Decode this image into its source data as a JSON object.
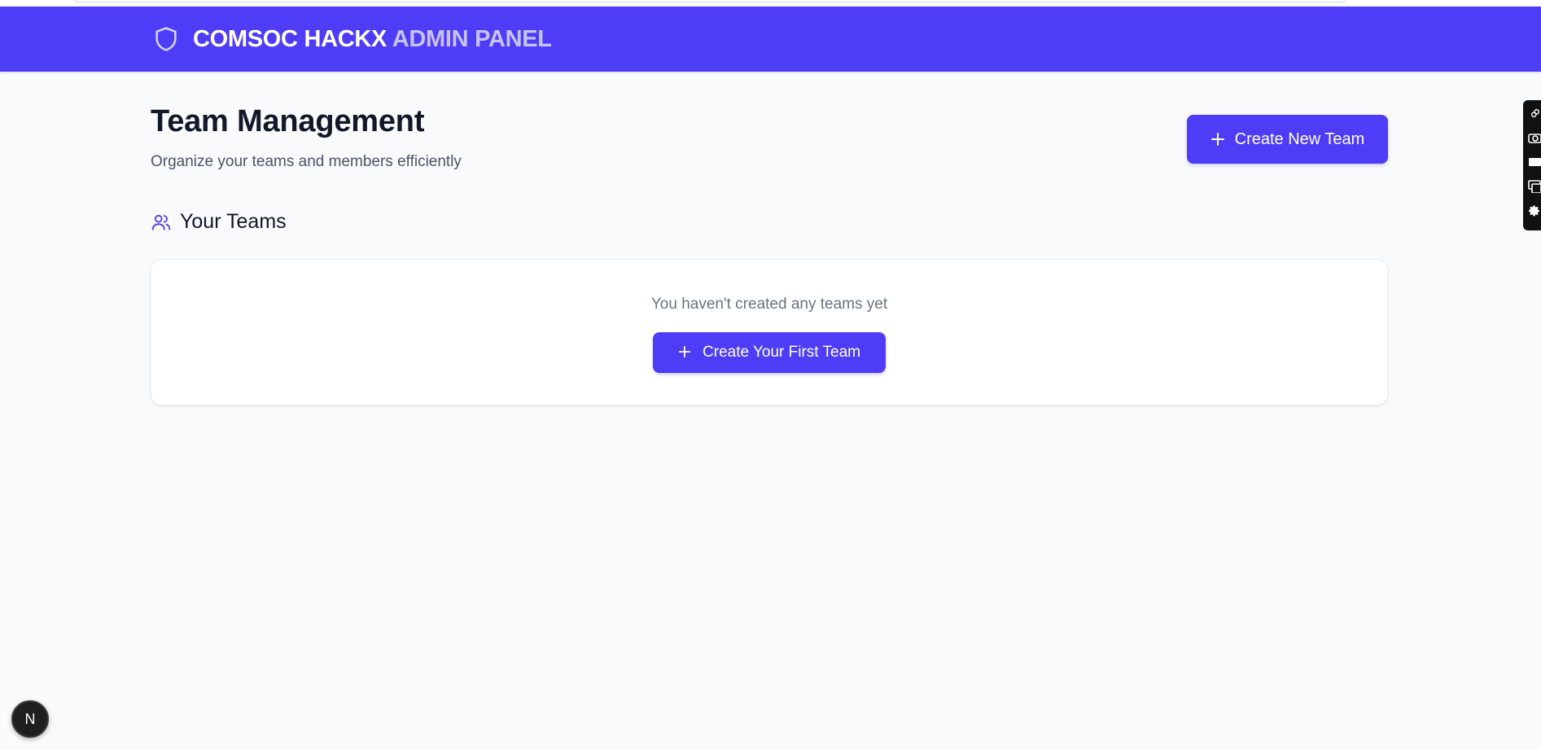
{
  "header": {
    "brand_primary": "COMSOC HACKX",
    "brand_secondary": "ADMIN PANEL",
    "brand_icon": "shield-icon",
    "accent_color": "#4f3cf6"
  },
  "main": {
    "title": "Team Management",
    "subtitle": "Organize your teams and members efficiently",
    "create_new_label": "Create New Team",
    "section_title": "Your Teams",
    "section_icon": "users-icon",
    "empty_state": {
      "message": "You haven't created any teams yet",
      "button_label": "Create Your First Team"
    }
  },
  "dev_tools": {
    "badge_letter": "N"
  }
}
